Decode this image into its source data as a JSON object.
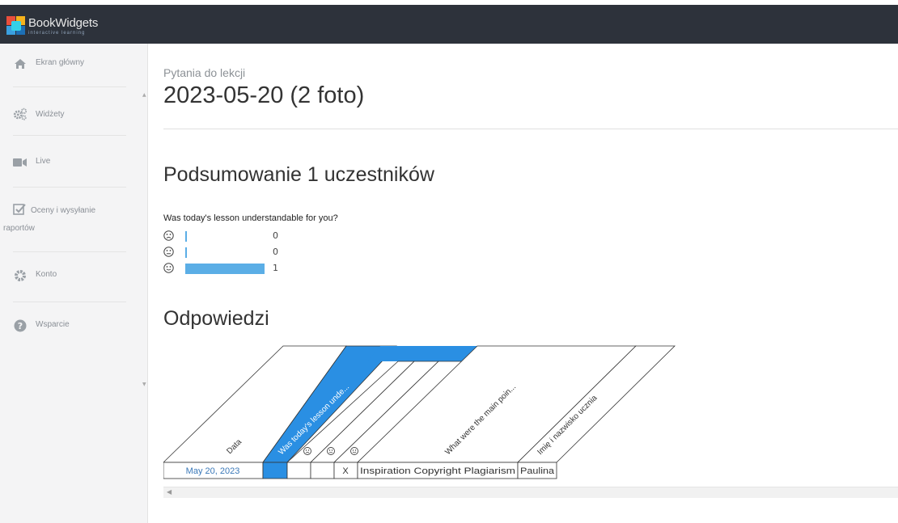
{
  "brand": {
    "name": "BookWidgets",
    "tagline": "interactive learning"
  },
  "sidebar": {
    "items": [
      {
        "label": "Ekran główny",
        "icon": "home-icon"
      },
      {
        "label": "Widżety",
        "icon": "gears-icon"
      },
      {
        "label": "Live",
        "icon": "video-camera-icon"
      },
      {
        "label": "Oceny i wysyłanie raportów",
        "icon": "checkbox-icon"
      },
      {
        "label": "Konto",
        "icon": "gear-icon"
      },
      {
        "label": "Wsparcie",
        "icon": "question-circle-icon"
      }
    ]
  },
  "page": {
    "subtitle": "Pytania do lekcji",
    "title": "2023-05-20 (2 foto)"
  },
  "summary": {
    "heading": "Podsumowanie 1 uczestników",
    "question": "Was today's lesson understandable for you?",
    "rows": [
      {
        "face": "sad",
        "count": "0",
        "fraction": 0
      },
      {
        "face": "neutral",
        "count": "0",
        "fraction": 0
      },
      {
        "face": "happy",
        "count": "1",
        "fraction": 1
      }
    ]
  },
  "answers": {
    "heading": "Odpowiedzi",
    "columns": [
      {
        "label": "Data"
      },
      {
        "label": "Was today's lesson unde..."
      },
      {
        "label": "sad-face"
      },
      {
        "label": "neutral-face"
      },
      {
        "label": "happy-face"
      },
      {
        "label": "What were the main poin..."
      },
      {
        "label": "Imię i nazwisko ucznia"
      }
    ],
    "row": {
      "date": "May 20, 2023",
      "cell_x": "X",
      "main_points": "Inspiration Copyright Plagiarism",
      "student": "Paulina"
    }
  },
  "colors": {
    "topbar": "#2d323b",
    "accent": "#2a8fe3",
    "bar": "#5baee6"
  }
}
